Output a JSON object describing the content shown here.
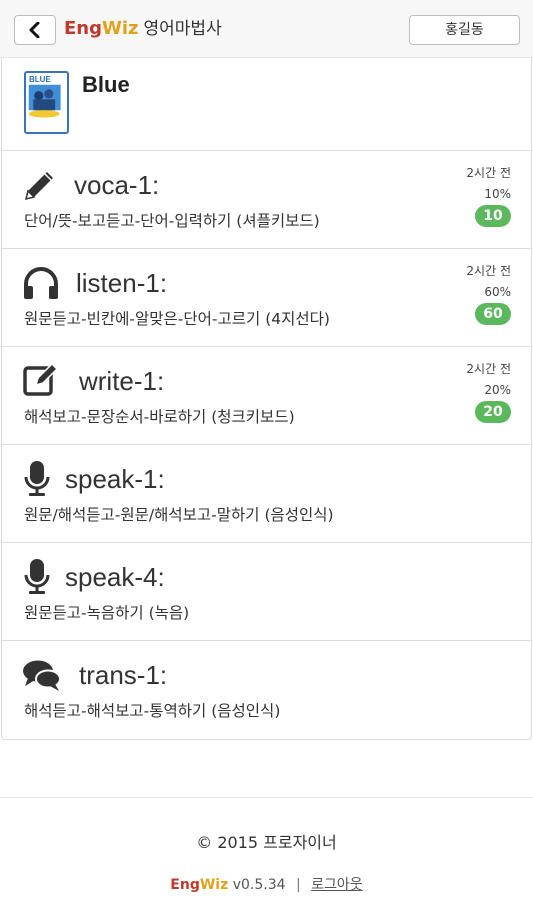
{
  "header": {
    "brand_eng": "Eng",
    "brand_wiz": "Wiz",
    "brand_sub": "영어마법사",
    "user_button": "홍길동",
    "back_icon": "chevron-left-icon"
  },
  "book": {
    "title": "Blue",
    "cover_label": "BLUE"
  },
  "lessons": [
    {
      "name": "voca-1:",
      "desc": "단어/뜻-보고듣고-단어-입력하기 (셔플키보드)",
      "icon": "pencil-icon",
      "time": "2시간 전",
      "percent": "10%",
      "badge": "10"
    },
    {
      "name": "listen-1:",
      "desc": "원문듣고-빈칸에-알맞은-단어-고르기 (4지선다)",
      "icon": "headphones-icon",
      "time": "2시간 전",
      "percent": "60%",
      "badge": "60"
    },
    {
      "name": "write-1:",
      "desc": "해석보고-문장순서-바로하기 (청크키보드)",
      "icon": "edit-icon",
      "time": "2시간 전",
      "percent": "20%",
      "badge": "20"
    },
    {
      "name": "speak-1:",
      "desc": "원문/해석듣고-원문/해석보고-말하기 (음성인식)",
      "icon": "microphone-icon"
    },
    {
      "name": "speak-4:",
      "desc": "원문듣고-녹음하기 (녹음)",
      "icon": "microphone-icon"
    },
    {
      "name": "trans-1:",
      "desc": "해석듣고-해석보고-통역하기 (음성인식)",
      "icon": "comments-icon"
    }
  ],
  "footer": {
    "copyright": "© 2015 프로자이너",
    "brand_eng": "Eng",
    "brand_wiz": "Wiz",
    "version": "v0.5.34",
    "separator": "|",
    "logout": "로그아웃"
  },
  "colors": {
    "brand_red": "#c0392b",
    "brand_yellow": "#e0a21a",
    "badge_green": "#5cb85c"
  }
}
